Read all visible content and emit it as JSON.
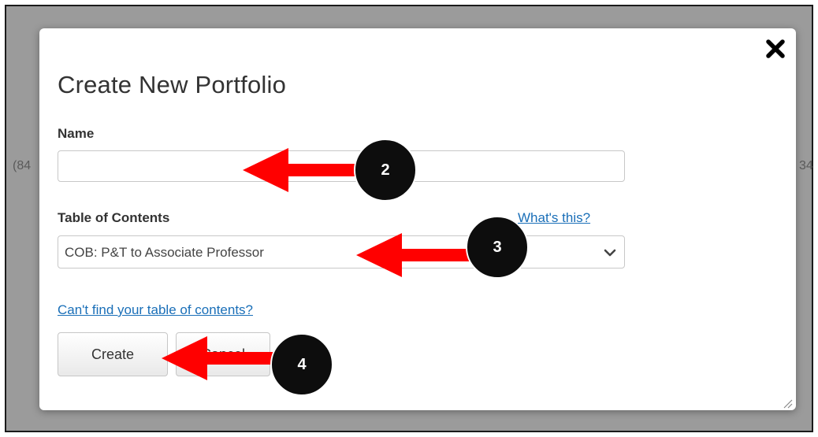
{
  "background": {
    "left_fragment": "(84",
    "right_fragment": "34"
  },
  "dialog": {
    "title": "Create New Portfolio",
    "close_icon": "close-x-icon",
    "name_label": "Name",
    "name_value": "",
    "toc_label": "Table of Contents",
    "toc_help_link": "What's this?",
    "toc_selected": "COB: P&T to Associate Professor",
    "toc_chevron_icon": "chevron-down-icon",
    "cant_find_link": "Can't find your table of contents?",
    "create_button": "Create",
    "cancel_button": "Cancel",
    "resize_icon": "resize-grip-icon"
  },
  "annotations": {
    "step_name": "2",
    "step_toc": "3",
    "step_create": "4",
    "arrow_color": "#ff0000",
    "marker_color": "#000000"
  },
  "colors": {
    "link": "#1a6fb8",
    "backdrop": "#9b9b9b"
  }
}
